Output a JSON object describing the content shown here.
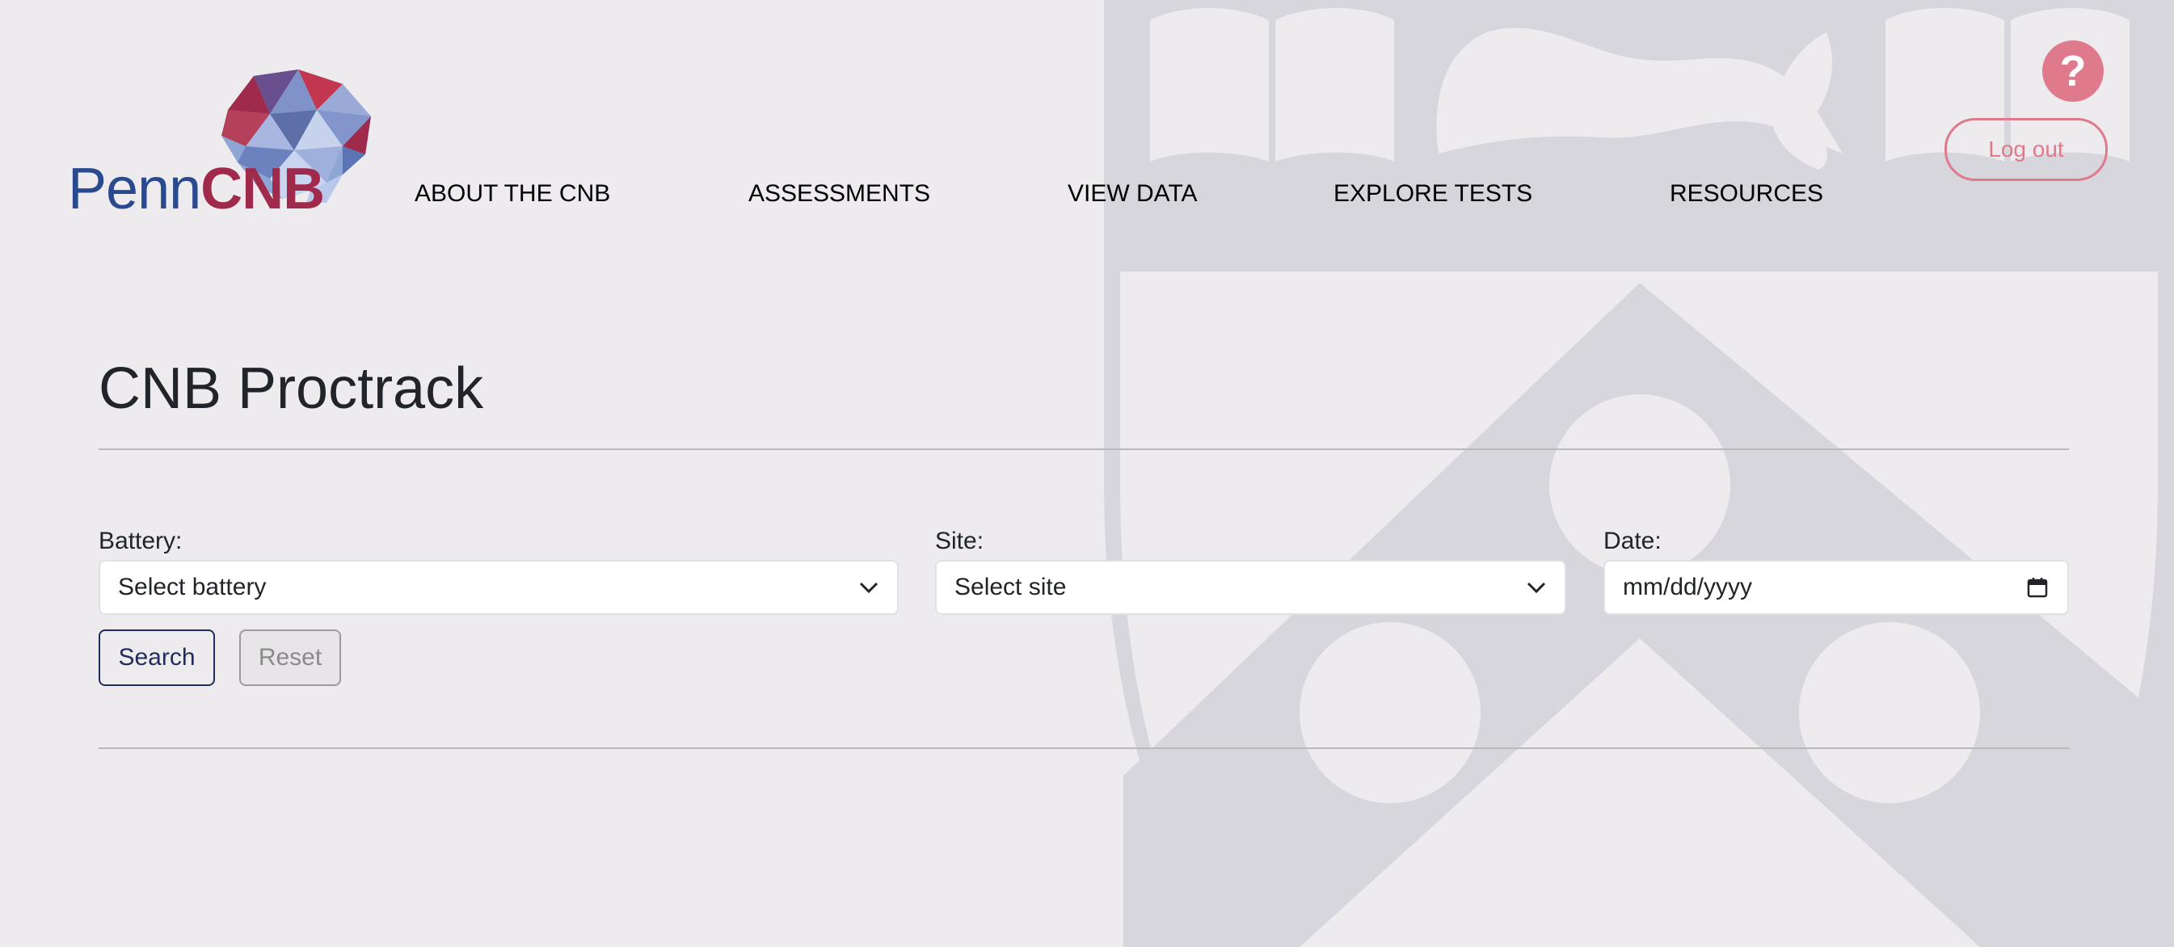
{
  "logo": {
    "penn": "Penn",
    "cnb": "CNB",
    "colors": {
      "penn": "#2a4a8f",
      "cnb": "#a02a4c"
    }
  },
  "nav": {
    "items": [
      {
        "label": "ABOUT THE CNB"
      },
      {
        "label": "ASSESSMENTS"
      },
      {
        "label": "VIEW DATA"
      },
      {
        "label": "EXPLORE TESTS"
      },
      {
        "label": "RESOURCES"
      }
    ]
  },
  "header": {
    "help_icon": "question-mark-icon",
    "help_label": "?",
    "logout_label": "Log out",
    "accent": "#df7a8d"
  },
  "main": {
    "title": "CNB Proctrack",
    "form": {
      "battery": {
        "label": "Battery:",
        "value": "Select battery",
        "icon": "chevron-down-icon"
      },
      "site": {
        "label": "Site:",
        "value": "Select site",
        "icon": "chevron-down-icon"
      },
      "date": {
        "label": "Date:",
        "placeholder": "mm/dd/yyyy",
        "icon": "calendar-icon"
      },
      "search_label": "Search",
      "reset_label": "Reset"
    }
  },
  "colors": {
    "background": "#edebed",
    "watermark": "#d6d6dc",
    "search_border": "#1f2d5c"
  }
}
